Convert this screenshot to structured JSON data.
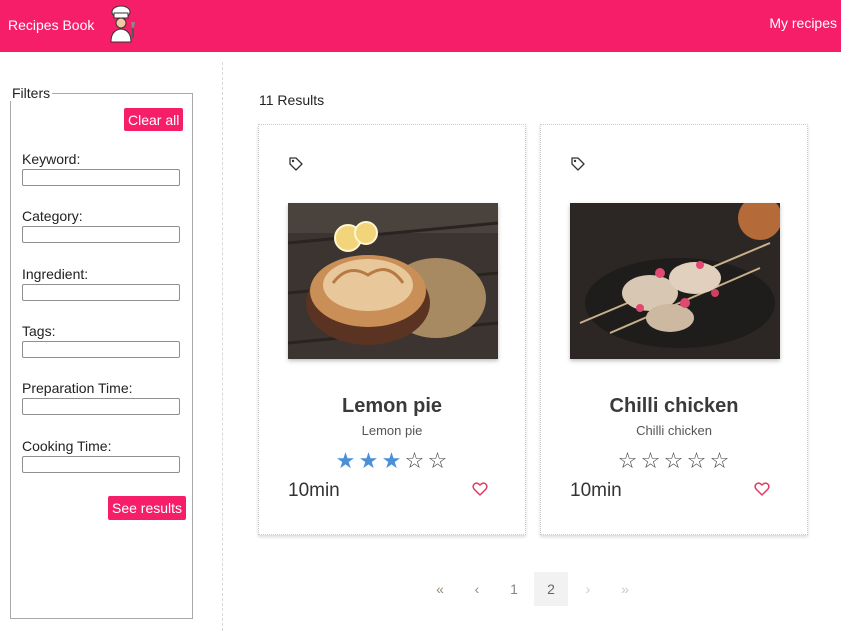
{
  "header": {
    "brand": "Recipes Book",
    "logo_icon": "chef-icon",
    "nav_link": "My recipes",
    "bg_color": "#f61e68"
  },
  "filters": {
    "legend": "Filters",
    "clear_label": "Clear all",
    "see_results_label": "See results",
    "fields": [
      {
        "label": "Keyword:",
        "value": ""
      },
      {
        "label": "Category:",
        "value": ""
      },
      {
        "label": "Ingredient:",
        "value": ""
      },
      {
        "label": "Tags:",
        "value": ""
      },
      {
        "label": "Preparation Time:",
        "value": ""
      },
      {
        "label": "Cooking Time:",
        "value": ""
      }
    ]
  },
  "results": {
    "count_text": "11 Results",
    "cards": [
      {
        "title": "Lemon pie",
        "subtitle": "Lemon pie",
        "time": "10min",
        "rating": 3,
        "max_rating": 5,
        "image_icon": "lemon-pie-photo",
        "tag_icon": "tag-icon",
        "favorite_icon": "heart-icon"
      },
      {
        "title": "Chilli chicken",
        "subtitle": "Chilli chicken",
        "time": "10min",
        "rating": 0,
        "max_rating": 5,
        "image_icon": "chilli-chicken-photo",
        "tag_icon": "tag-icon",
        "favorite_icon": "heart-icon"
      }
    ]
  },
  "pagination": {
    "first": "«",
    "prev": "‹",
    "pages": [
      "1",
      "2"
    ],
    "current": "2",
    "next": "›",
    "last": "»"
  },
  "colors": {
    "accent": "#f61e68",
    "star_on": "#4a90d9",
    "heart": "#e03a5f"
  }
}
